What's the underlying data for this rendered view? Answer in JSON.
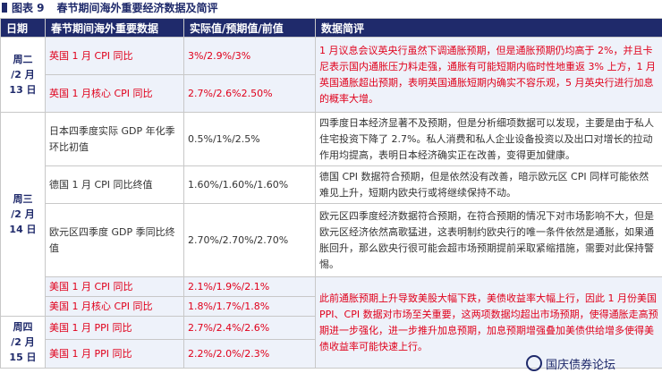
{
  "caption": {
    "figure_no": "图表 9",
    "title": "春节期间海外重要经济数据及简评"
  },
  "headers": {
    "date": "日期",
    "item": "春节期间海外重要数据",
    "value": "实际值/预期值/前值",
    "comment": "数据简评"
  },
  "dates": {
    "d13": [
      "周二",
      "/2 月",
      "13 日"
    ],
    "d14": [
      "周三",
      "/2 月",
      "14 日"
    ],
    "d15": [
      "周四",
      "/2 月",
      "15 日"
    ]
  },
  "rows": [
    {
      "item": "英国 1 月 CPI 同比",
      "value": "3%/2.9%/3%"
    },
    {
      "item": "英国 1 月核心 CPI 同比",
      "value": "2.7%/2.6%2.50%"
    },
    {
      "item": "日本四季度实际 GDP 年化季环比初值",
      "value": "0.5%/1%/2.5%"
    },
    {
      "item": "德国 1 月 CPI 同比终值",
      "value": "1.60%/1.60%/1.60%"
    },
    {
      "item": "欧元区四季度 GDP 季同比终值",
      "value": "2.70%/2.70%/2.70%"
    },
    {
      "item": "美国 1 月 CPI 同比",
      "value": "2.1%/1.9%/2.1%"
    },
    {
      "item": "美国 1 月核心 CPI 同比",
      "value": "1.8%/1.7%/1.8%"
    },
    {
      "item": "美国 1 月 PPI 同比",
      "value": "2.7%/2.4%/2.6%"
    },
    {
      "item": "美国 1 月 PPI 同比",
      "value": "2.2%/2.0%/2.3%"
    }
  ],
  "comments": {
    "uk": "1 月议息会议英央行虽然下调通胀预期，但是通胀预期仍均高于 2%，并且卡尼表示国内通胀压力料走强，通胀有可能短期内临时性地重返 3% 上方，1 月英国通胀超出预期，表明英国通胀短期内确实不容乐观，5 月英央行进行加息的概率大增。",
    "japan": "四季度日本经济显著不及预期，但是分析细项数据可以发现，主要是由于私人住宅投资下降了 2.7%。私人消费和私人企业设备投资以及出口对增长的拉动作用均提高，表明日本经济确实正在改善，变得更加健康。",
    "germany": "德国 CPI 数据符合预期，但是依然没有改善，暗示欧元区 CPI 同样可能依然难见上升，短期内欧央行或将继续保持不动。",
    "eurozone": "欧元区四季度经济数据符合预期，在符合预期的情况下对市场影响不大，但是欧元区经济依然高歌猛进，这表明制约欧央行的唯一条件依然是通胀，如果通胀回升，那么欧央行很可能会超市场预期提前采取紧缩措施，需要对此保持警惕。",
    "us": "此前通胀预期上升导致美股大幅下跌，美债收益率大幅上行，因此 1 月份美国 PPI、CPI 数据对市场至关重要，这两项数据均超出市场预期，使得通胀走高预期进一步强化，进一步推升加息预期，加息预期增强叠加美债供给增多使得美债收益率可能快速上行。"
  },
  "watermark": "国庆债券论坛"
}
